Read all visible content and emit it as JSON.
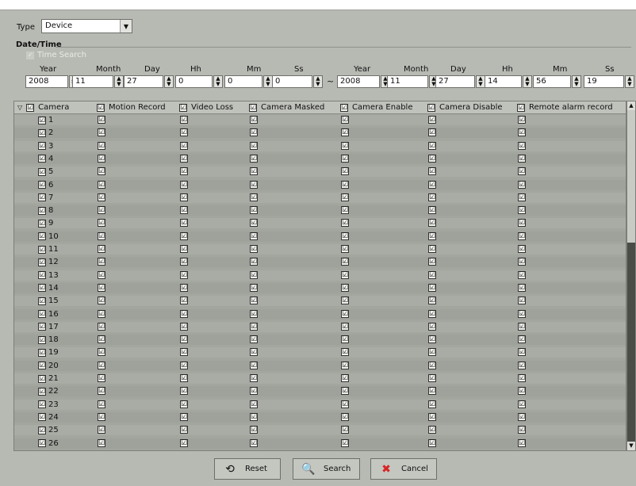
{
  "type_filter": {
    "label": "Type",
    "value": "Device"
  },
  "date_time": {
    "title": "Date/Time",
    "time_search_label": "Time Search",
    "headers": [
      "Year",
      "Month",
      "Day",
      "Hh",
      "Mm",
      "Ss"
    ],
    "from": [
      "2008",
      "11",
      "27",
      "0",
      "0",
      "0"
    ],
    "separator": "~",
    "to": [
      "2008",
      "11",
      "27",
      "14",
      "56",
      "19"
    ]
  },
  "table": {
    "columns": [
      "Camera",
      "Motion Record",
      "Video Loss",
      "Camera Masked",
      "Camera Enable",
      "Camera Disable",
      "Remote alarm record"
    ],
    "rows": [
      "1",
      "2",
      "3",
      "4",
      "5",
      "6",
      "7",
      "8",
      "9",
      "10",
      "11",
      "12",
      "13",
      "14",
      "15",
      "16",
      "17",
      "18",
      "19",
      "20",
      "21",
      "22",
      "23",
      "24",
      "25",
      "26"
    ],
    "check_glyph": "☑",
    "tree_glyph": "▽"
  },
  "buttons": {
    "reset": "Reset",
    "search": "Search",
    "cancel": "Cancel"
  },
  "icons": {
    "reset": "reset-icon",
    "search": "search-icon",
    "cancel": "cancel-icon"
  },
  "colors": {
    "cancel_icon": "#d82424"
  }
}
